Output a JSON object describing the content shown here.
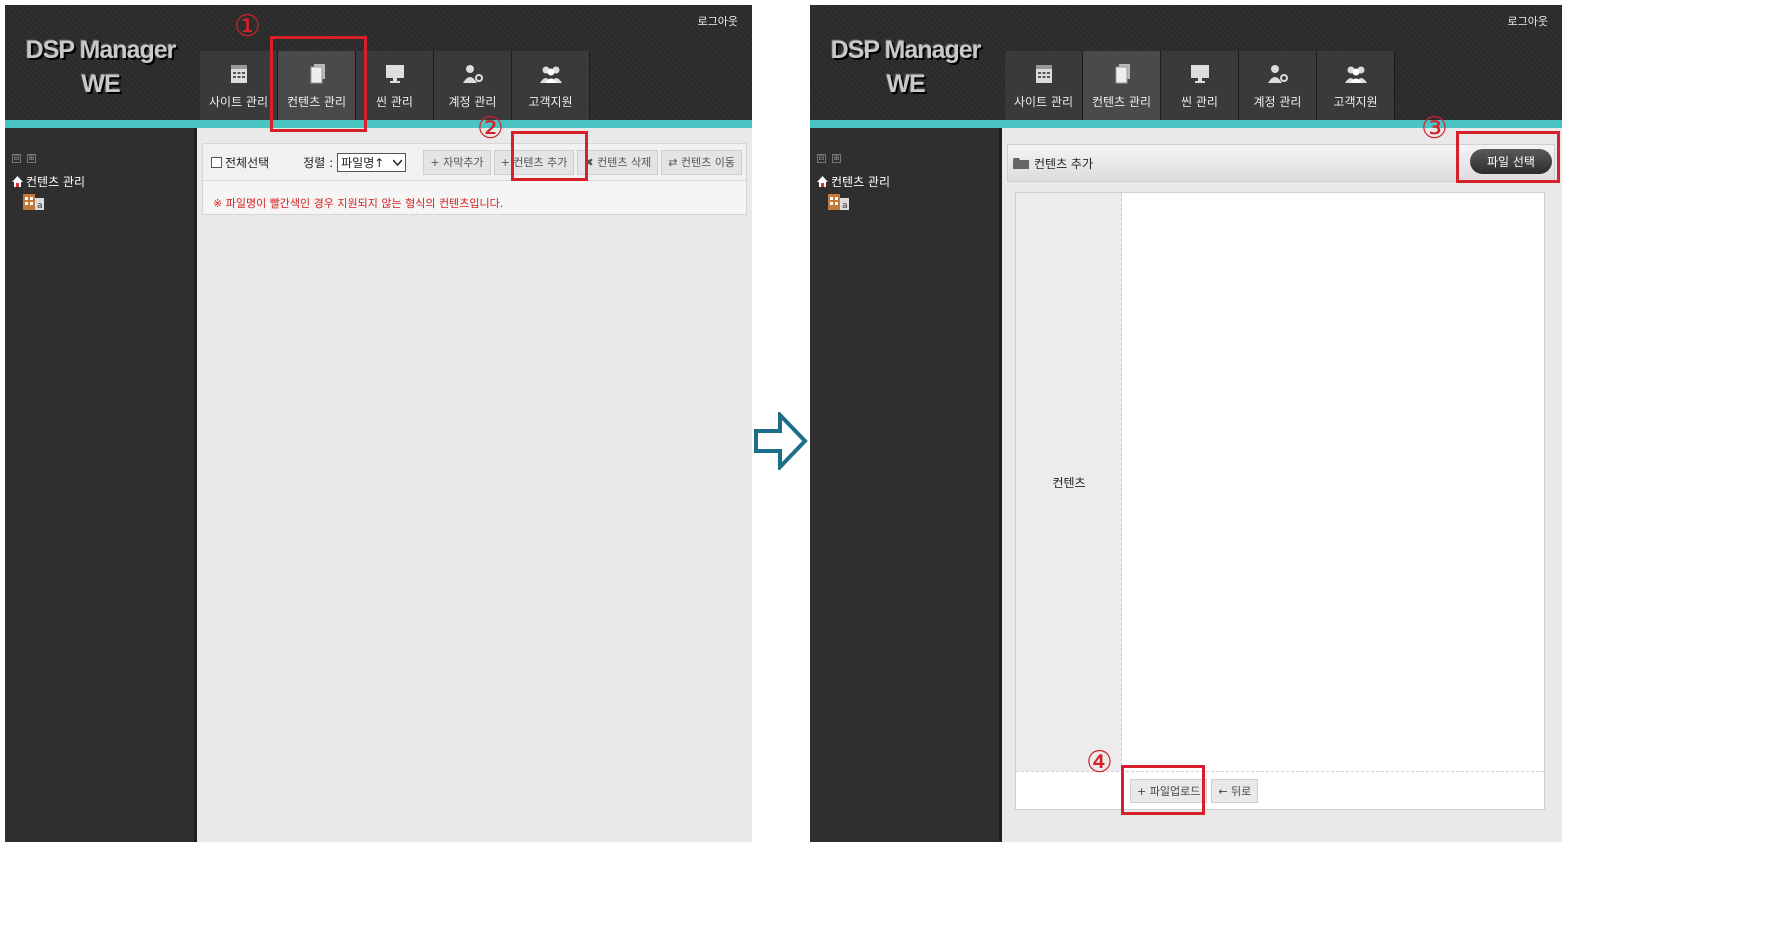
{
  "app": {
    "logo_line1": "DSP Manager",
    "logo_line2": "WE",
    "logout": "로그아웃"
  },
  "nav": {
    "items": [
      {
        "label": "사이트 관리",
        "icon": "calendar-icon"
      },
      {
        "label": "컨텐츠 관리",
        "icon": "documents-icon"
      },
      {
        "label": "씬 관리",
        "icon": "monitor-icon"
      },
      {
        "label": "계정 관리",
        "icon": "user-settings-icon"
      },
      {
        "label": "고객지원",
        "icon": "users-icon"
      }
    ],
    "active_index": 1
  },
  "sidebar": {
    "tree_collapse": "⊟",
    "tree_expand": "⊞",
    "root_label": "컨텐츠 관리",
    "child_label": "a"
  },
  "left_screen": {
    "select_all": "전체선택",
    "sort_label": "정렬 :",
    "sort_value": "파일명↑",
    "buttons": {
      "add_subtitle": "+ 자막추가",
      "add_content": "+ 컨텐츠 추가",
      "delete_content": "✖ 컨텐츠 삭제",
      "move_content": "⇄ 컨텐츠 이동"
    },
    "notice": "※ 파일명이 빨간색인 경우 지원되지 않는 형식의 컨텐츠입니다."
  },
  "right_screen": {
    "panel_title": "컨텐츠 추가",
    "file_select": "파일 선택",
    "content_label": "컨텐츠",
    "upload": "+ 파일업로드",
    "back": "← 뒤로"
  },
  "annotations": {
    "step1": "①",
    "step2": "②",
    "step3": "③",
    "step4": "④",
    "accent_color": "#d6202a"
  },
  "colors": {
    "header": "#2a2a2a",
    "teal": "#4ac3c3",
    "sidebar": "#2f2f2f",
    "arrow": "#1e6e8a"
  }
}
